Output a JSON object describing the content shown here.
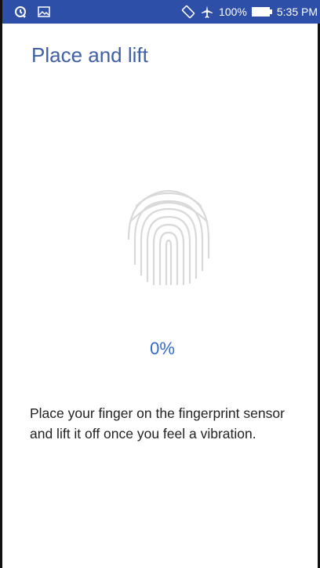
{
  "status_bar": {
    "left_icons": [
      "sync-icon",
      "image-icon"
    ],
    "right_icons": [
      "rotation-icon",
      "airplane-mode-icon",
      "battery-icon"
    ],
    "battery": "100%",
    "time": "5:35 PM"
  },
  "page": {
    "title": "Place and lift",
    "progress": "0%",
    "instructions": "Place your finger on the fingerprint sensor and lift it off once you feel a vibration."
  },
  "colors": {
    "status_bar": "#2e4fa8",
    "title": "#3f5fa6",
    "progress": "#2f6bc9",
    "fingerprint": "#d9d9d9"
  }
}
